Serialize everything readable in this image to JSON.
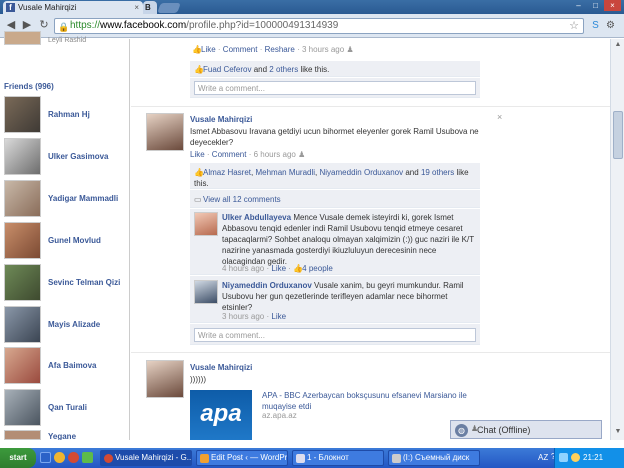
{
  "browser": {
    "tabs": [
      {
        "label": "Vusale Mahirqizi"
      },
      {
        "label": "B"
      }
    ],
    "url": {
      "https": "https://",
      "domain": "www.facebook.com",
      "path": "/profile.php?id=100000491314939"
    }
  },
  "sidebar": {
    "top_partial": "Leyli Rashid",
    "friends_heading": "Friends (996)",
    "friends": [
      {
        "name": "Rahman Hj"
      },
      {
        "name": "Ulker Gasimova"
      },
      {
        "name": "Yadigar Mammadli"
      },
      {
        "name": "Gunel Movlud"
      },
      {
        "name": "Sevinc Telman Qizi"
      },
      {
        "name": "Mayis Alizade"
      },
      {
        "name": "Afa Baimova"
      },
      {
        "name": "Qan Turali"
      },
      {
        "name": "Yegane"
      }
    ]
  },
  "post0": {
    "actions": {
      "like": "Like",
      "comment": "Comment",
      "reshare": "Reshare",
      "time": "3 hours ago"
    },
    "likes": {
      "person": "Fuad Ceferov",
      "and": "and",
      "others": "2 others",
      "tail": "like this."
    },
    "comment_placeholder": "Write a comment..."
  },
  "post1": {
    "author": "Vusale Mahirqizi",
    "text": "Ismet Abbasovu Iravana getdiyi ucun bihormet eleyenler gorek Ramil Usubova ne deyecekler?",
    "actions": {
      "like": "Like",
      "comment": "Comment",
      "time": "6 hours ago"
    },
    "likes": {
      "p1": "Almaz Hasret",
      "p2": "Mehman Muradli",
      "p3": "Niyameddin Orduxanov",
      "and": "and",
      "others": "19 others",
      "tail": "like this."
    },
    "view_all": "View all 12 comments",
    "comments": [
      {
        "author": "Ulker Abdullayeva",
        "text": "Mence Vusale demek isteyirdi ki, gorek Ismet Abbasovu tenqid edenler indi Ramil Usubovu tenqid etmeye cesaret tapacaqlarmi? Sohbet analoqu olmayan xalqimizin (:)) guc naziri ile K/T nazirine yanasmada gosterdiyi ikiuzluluyun derecesinin nece olacagindan gedir.",
        "time": "4 hours ago",
        "like": "Like",
        "people": "4 people"
      },
      {
        "author": "Niyameddin Orduxanov",
        "text": "Vusale xanim, bu geyri mumkundur. Ramil Usubovu her gun qezetlerinde terifleyen adamlar nece bihormet etsinler?",
        "time": "3 hours ago",
        "like": "Like"
      }
    ],
    "comment_placeholder": "Write a comment..."
  },
  "post2": {
    "author": "Vusale Mahirqizi",
    "text": "))))))",
    "link_title": "APA - BBC Azerbaycan boksçusunu efsanevi Marsiano ile muqayise etdi",
    "link_domain": "az.apa.az",
    "thumb_text": "apa"
  },
  "chat": {
    "label": "Chat (Offline)"
  },
  "taskbar": {
    "start": "start",
    "buttons": [
      {
        "label": "Vusale Mahirqizi - G..."
      },
      {
        "label": "Edit Post ‹ — WordPr..."
      },
      {
        "label": "1 - Блокнот"
      },
      {
        "label": "(I:) Съемный диск"
      }
    ],
    "lang": "AZ",
    "clock": "21:21"
  },
  "colors": {
    "facebook_blue": "#3b5998",
    "like_box": "#edeff4",
    "taskbar": "#2356c4"
  }
}
